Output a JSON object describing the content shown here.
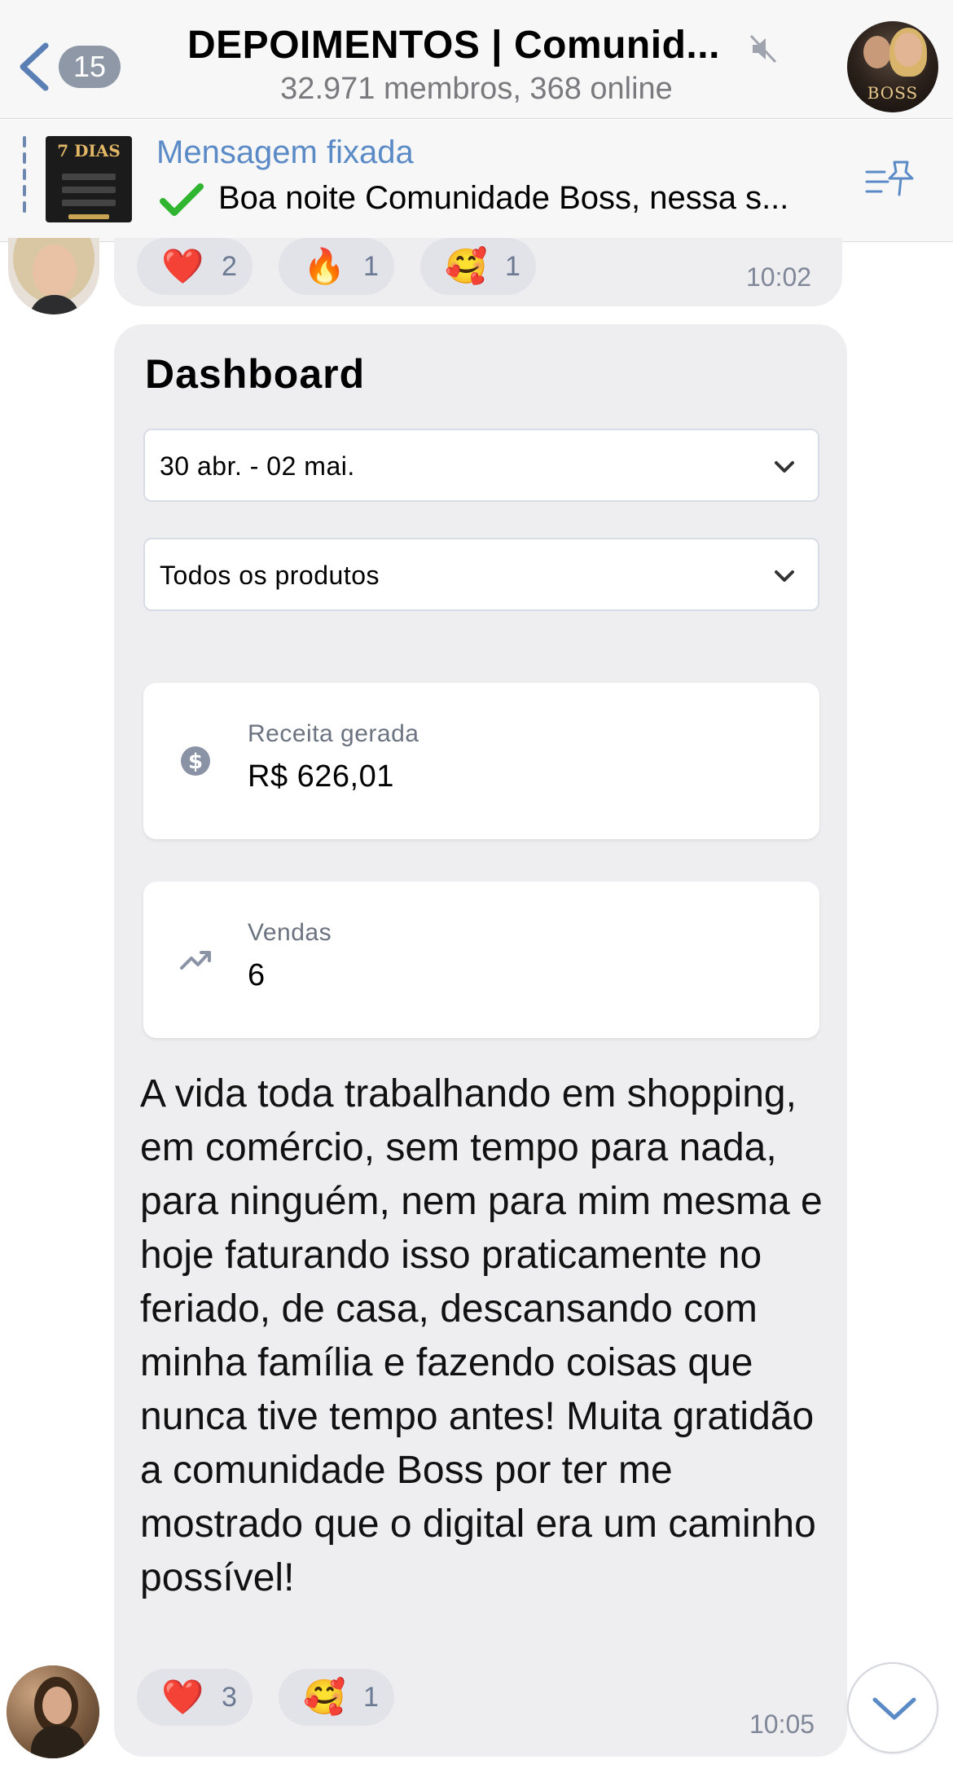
{
  "header": {
    "back_badge": "15",
    "title": "DEPOIMENTOS | Comunid...",
    "subtitle": "32.971 membros, 368 online",
    "avatar_brand": "BOSS"
  },
  "pinned": {
    "title": "Mensagem fixada",
    "text": "Boa noite Comunidade Boss, nessa s...",
    "thumb_title": "7 DIAS"
  },
  "message1": {
    "reactions": [
      {
        "emoji": "❤️",
        "count": "2"
      },
      {
        "emoji": "🔥",
        "count": "1"
      },
      {
        "emoji": "🥰",
        "count": "1"
      }
    ],
    "time": "10:02"
  },
  "dashboard": {
    "title": "Dashboard",
    "date_range": "30 abr. - 02 mai.",
    "product_filter": "Todos os produtos",
    "revenue_label": "Receita gerada",
    "revenue_value": "R$ 626,01",
    "sales_label": "Vendas",
    "sales_value": "6"
  },
  "message2": {
    "text": "A vida toda trabalhando em shopping, em comércio, sem tempo para nada, para ninguém, nem para mim mesma e hoje faturando isso praticamente no feriado, de casa, descansando com minha família e fazendo coisas que nunca tive tempo antes! Muita gratidão a comunidade Boss por ter me mostrado que o digital era um caminho possível!",
    "reactions": [
      {
        "emoji": "❤️",
        "count": "3"
      },
      {
        "emoji": "🥰",
        "count": "1"
      }
    ],
    "time": "10:05"
  },
  "colors": {
    "accent": "#5b8bc6",
    "bubble": "#eeeef1",
    "reaction_bg": "#e2e3e9",
    "badge": "#8e98a6"
  }
}
